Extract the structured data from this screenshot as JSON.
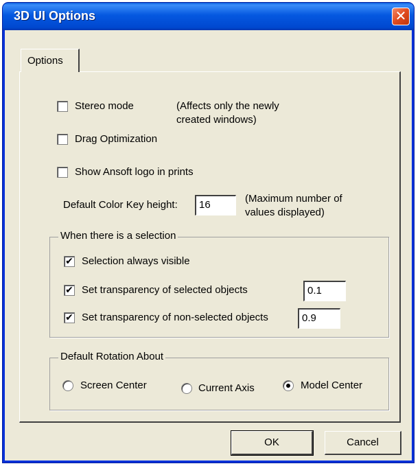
{
  "window": {
    "title": "3D UI Options",
    "close_glyph": "✕"
  },
  "tabs": [
    {
      "label": "Options"
    }
  ],
  "options": {
    "stereo_mode": {
      "label": "Stereo mode",
      "checked": false,
      "note_line1": "(Affects only the newly",
      "note_line2": "created windows)"
    },
    "drag_optimization": {
      "label": "Drag Optimization",
      "checked": false
    },
    "show_logo": {
      "label": "Show Ansoft logo in prints",
      "checked": false
    },
    "color_key": {
      "label": "Default Color Key height:",
      "value": "16",
      "note_line1": "(Maximum number of",
      "note_line2": "values displayed)"
    }
  },
  "selection_group": {
    "title": "When there is a selection",
    "always_visible": {
      "label": "Selection always visible",
      "checked": true,
      "mark": "✔"
    },
    "transparency_selected": {
      "label": "Set transparency of selected objects",
      "checked": true,
      "mark": "✔",
      "value": "0.1"
    },
    "transparency_nonselected": {
      "label": "Set transparency of non-selected objects",
      "checked": true,
      "mark": "✔",
      "value": "0.9"
    }
  },
  "rotation_group": {
    "title": "Default Rotation About",
    "options": [
      {
        "label": "Screen Center",
        "selected": false
      },
      {
        "label": "Current Axis",
        "selected": false
      },
      {
        "label": "Model Center",
        "selected": true
      }
    ]
  },
  "buttons": {
    "ok": "OK",
    "cancel": "Cancel"
  },
  "colors": {
    "titlebar": "#0558e0",
    "dialog_bg": "#ece9d8",
    "close_button": "#e04a1e"
  }
}
